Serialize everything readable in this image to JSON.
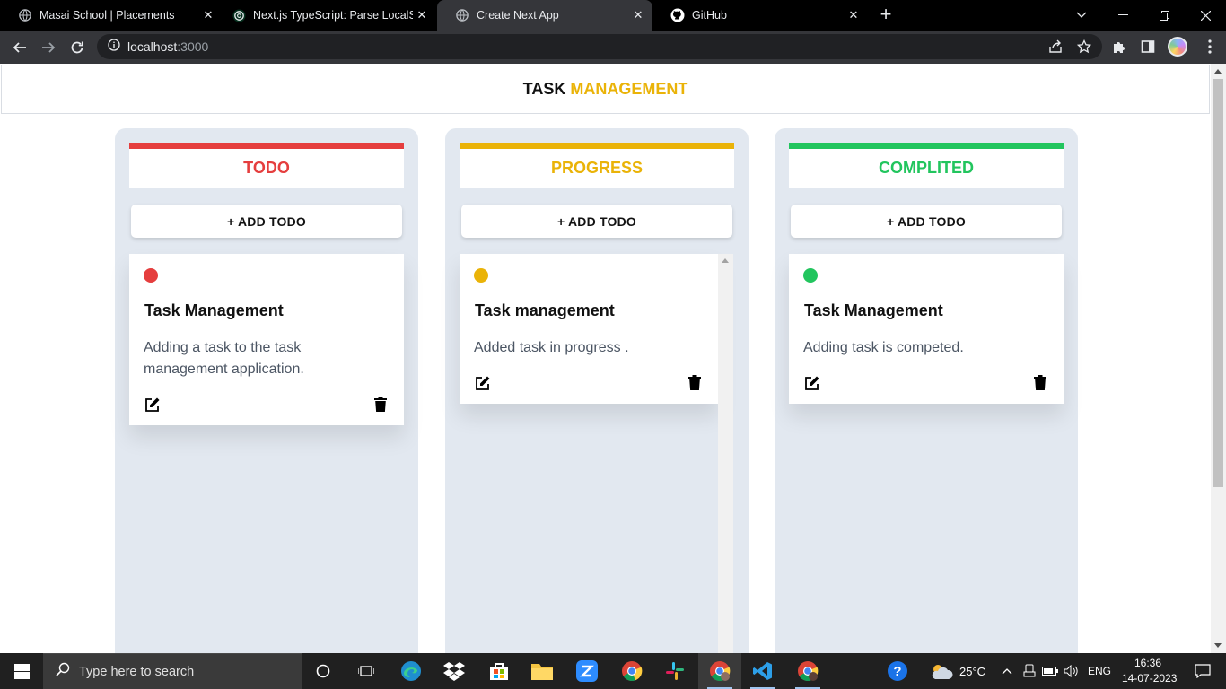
{
  "browser": {
    "tabs": [
      {
        "title": "Masai School | Placements",
        "icon": "globe-icon",
        "active": false
      },
      {
        "title": "Next.js TypeScript: Parse LocalSto",
        "icon": "chatgpt-icon",
        "active": false
      },
      {
        "title": "Create Next App",
        "icon": "globe-icon",
        "active": true
      },
      {
        "title": "GitHub",
        "icon": "github-icon",
        "active": false
      }
    ],
    "url_host": "localhost",
    "url_port": ":3000"
  },
  "app": {
    "title_part1": "TASK",
    "title_part2": "MANAGEMENT",
    "columns": [
      {
        "title": "TODO",
        "color": "#e53e3e",
        "add_label": "+ ADD TODO",
        "cards": [
          {
            "title": "Task Management",
            "description": "Adding a task to the task management application."
          }
        ]
      },
      {
        "title": "PROGRESS",
        "color": "#eab308",
        "add_label": "+ ADD TODO",
        "cards": [
          {
            "title": "Task management",
            "description": "Added task in progress ."
          }
        ]
      },
      {
        "title": "COMPLITED",
        "color": "#22c55e",
        "add_label": "+ ADD TODO",
        "cards": [
          {
            "title": "Task Management",
            "description": "Adding task is competed."
          }
        ]
      }
    ]
  },
  "taskbar": {
    "search_placeholder": "Type here to search",
    "weather": "25°C",
    "language": "ENG",
    "time": "16:36",
    "date": "14-07-2023"
  }
}
